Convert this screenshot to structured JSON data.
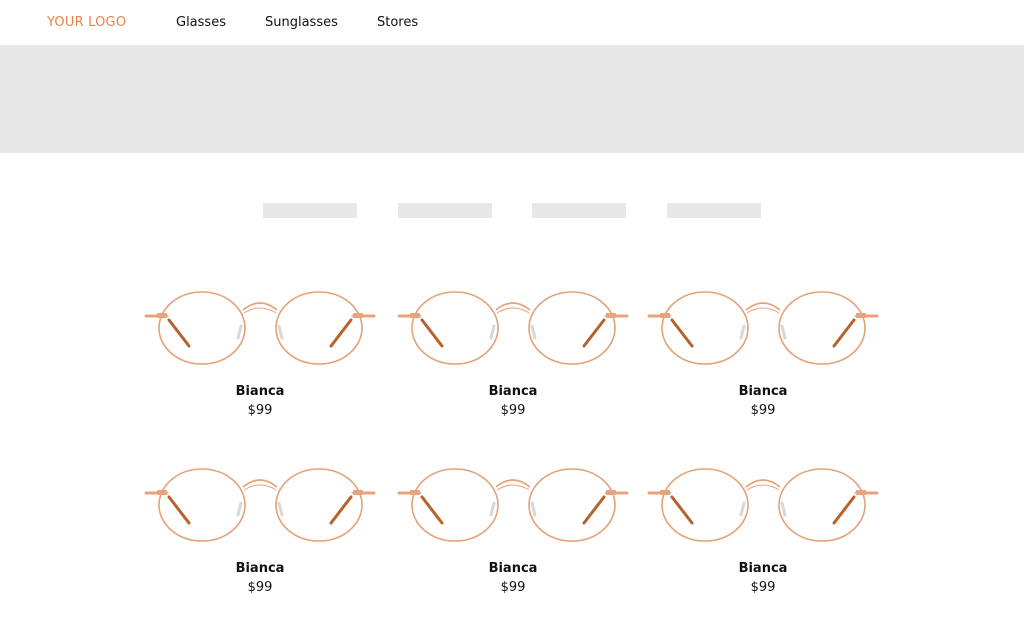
{
  "header": {
    "logo": "YOUR LOGO",
    "nav": [
      "Glasses",
      "Sunglasses",
      "Stores"
    ]
  },
  "colors": {
    "logo": "#e8844f",
    "placeholder": "#e8e8e8",
    "frame": "#e4a27a",
    "temple": "#b5622c"
  },
  "products": [
    {
      "name": "Bianca",
      "price": "$99",
      "image": "glasses-image"
    },
    {
      "name": "Bianca",
      "price": "$99",
      "image": "glasses-image"
    },
    {
      "name": "Bianca",
      "price": "$99",
      "image": "glasses-image"
    },
    {
      "name": "Bianca",
      "price": "$99",
      "image": "glasses-image"
    },
    {
      "name": "Bianca",
      "price": "$99",
      "image": "glasses-image"
    },
    {
      "name": "Bianca",
      "price": "$99",
      "image": "glasses-image"
    }
  ]
}
